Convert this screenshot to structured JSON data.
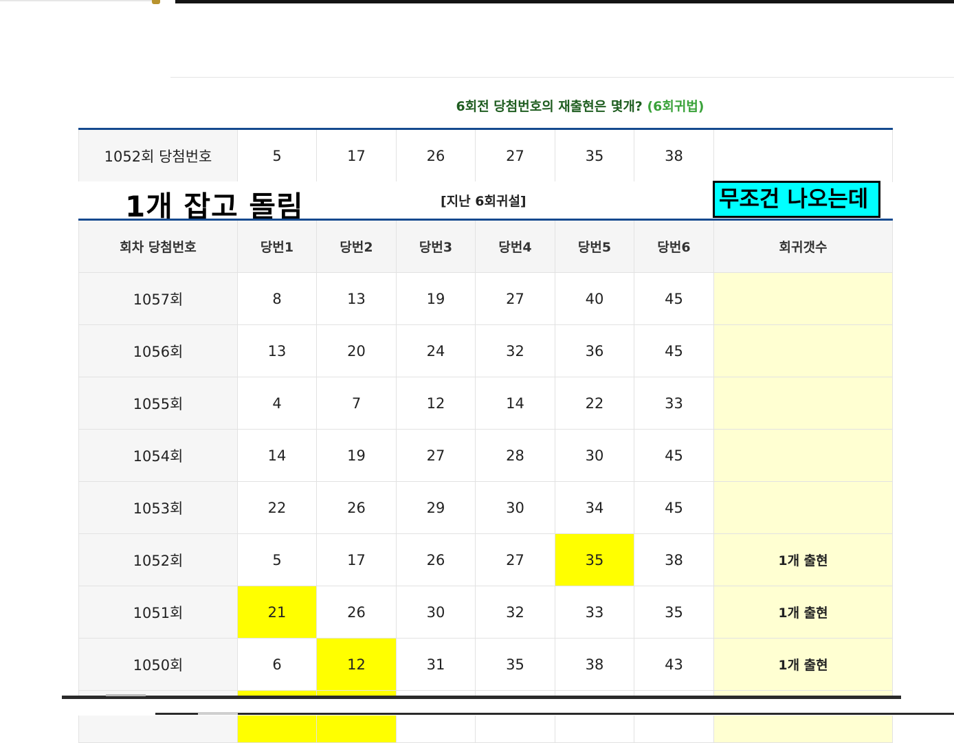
{
  "heading": {
    "main": "6회전 당첨번호의 재출현은 몇개?",
    "sub": "(6회귀법)"
  },
  "winning": {
    "label": "1052회 당첨번호",
    "numbers": [
      "5",
      "17",
      "26",
      "27",
      "35",
      "38"
    ]
  },
  "notes": {
    "left": "1개 잡고 돌림",
    "center": "[지난 6회귀설]",
    "right": "무조건 나오는데"
  },
  "headers": [
    "회차 당첨번호",
    "당번1",
    "당번2",
    "당번3",
    "당번4",
    "당번5",
    "당번6",
    "회귀갯수"
  ],
  "rows": [
    {
      "round": "1057회",
      "nums": [
        "8",
        "13",
        "19",
        "27",
        "40",
        "45"
      ],
      "count": ""
    },
    {
      "round": "1056회",
      "nums": [
        "13",
        "20",
        "24",
        "32",
        "36",
        "45"
      ],
      "count": ""
    },
    {
      "round": "1055회",
      "nums": [
        "4",
        "7",
        "12",
        "14",
        "22",
        "33"
      ],
      "count": ""
    },
    {
      "round": "1054회",
      "nums": [
        "14",
        "19",
        "27",
        "28",
        "30",
        "45"
      ],
      "count": ""
    },
    {
      "round": "1053회",
      "nums": [
        "22",
        "26",
        "29",
        "30",
        "34",
        "45"
      ],
      "count": ""
    },
    {
      "round": "1052회",
      "nums": [
        "5",
        "17",
        "26",
        "27",
        "35",
        "38"
      ],
      "count": "1개 출현",
      "highlight": 4
    },
    {
      "round": "1051회",
      "nums": [
        "21",
        "26",
        "30",
        "32",
        "33",
        "35"
      ],
      "count": "1개 출현",
      "highlight": 0
    },
    {
      "round": "1050회",
      "nums": [
        "6",
        "12",
        "31",
        "35",
        "38",
        "43"
      ],
      "count": "1개 출현",
      "highlight": 1
    }
  ],
  "colors": {
    "highlight": "#ffff00",
    "count_bg": "#ffffd2",
    "header_green": "#1f5d20",
    "sub_green": "#3aa23a",
    "rule_blue": "#14498e",
    "note_cyan": "#00ffff"
  }
}
